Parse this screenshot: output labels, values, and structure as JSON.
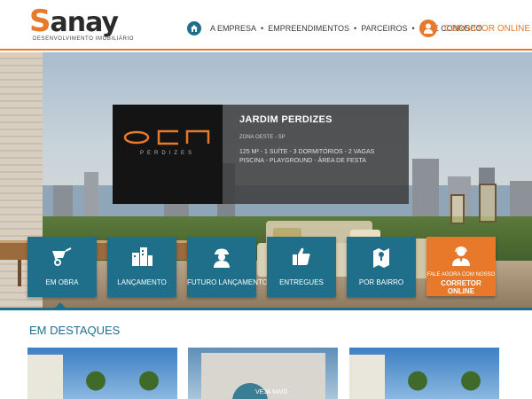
{
  "header": {
    "logo_word": "anay",
    "logo_initial": "S",
    "logo_tagline": "DESENVOLVIMENTO IMOBILIÁRIO",
    "nav": [
      "A EMPRESA",
      "EMPREENDIMENTOS",
      "PARCEIROS",
      "FALE CONOSCO"
    ],
    "nav_separator": "•",
    "corretor_label": "CORRETOR ONLINE"
  },
  "feature": {
    "logo_sub": "PERDIZES",
    "title": "JARDIM PERDIZES",
    "region": "ZONA OESTE - SP",
    "spec_line1": "125 M² - 1 SUÍTE - 3 DORMITÓRIOS - 2 VAGAS",
    "spec_line2": "PISCINA - PLAYGROUND - ÁREA DE FESTA"
  },
  "tiles": [
    {
      "label": "EM OBRA",
      "icon": "wheelbarrow-icon"
    },
    {
      "label": "LANÇAMENTO",
      "icon": "buildings-icon"
    },
    {
      "label": "FUTURO LANÇAMENTO",
      "icon": "worker-icon"
    },
    {
      "label": "ENTREGUES",
      "icon": "thumbs-up-icon"
    },
    {
      "label": "POR BAIRRO",
      "icon": "map-pin-icon"
    }
  ],
  "cta_tile": {
    "small": "FALE AGORA COM NOSSO",
    "big": "CORRETOR ONLINE",
    "icon": "agent-icon"
  },
  "destaques": {
    "title": "EM DESTAQUES",
    "ver_mais": "VEJA MAIS"
  },
  "colors": {
    "brand_blue": "#1f6f8b",
    "brand_orange": "#e8792a"
  }
}
